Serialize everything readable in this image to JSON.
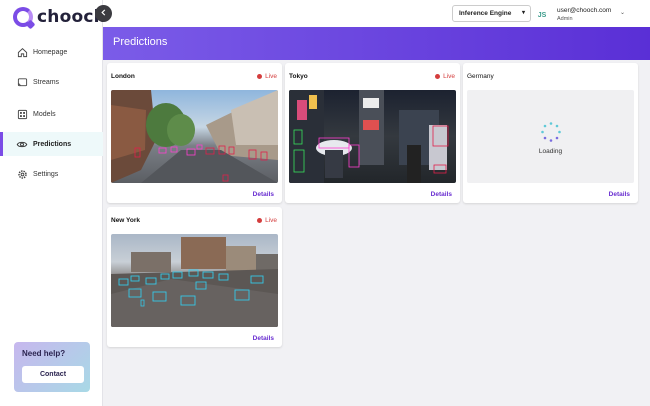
{
  "app": {
    "logo_text": "chooch"
  },
  "sidebar": {
    "items": [
      {
        "label": "Homepage",
        "icon": "home-icon"
      },
      {
        "label": "Streams",
        "icon": "cast-icon"
      },
      {
        "label": "Models",
        "icon": "models-icon"
      },
      {
        "label": "Predictions",
        "icon": "eye-icon",
        "active": true
      },
      {
        "label": "Settings",
        "icon": "gear-icon"
      }
    ],
    "help": {
      "title": "Need help?",
      "button": "Contact"
    }
  },
  "header": {
    "engine_select": "Inference Engine",
    "avatar_initials": "JS",
    "user_email": "user@chooch.com",
    "user_role": "Admin"
  },
  "page": {
    "title": "Predictions"
  },
  "cards": [
    {
      "title": "London",
      "status": "Live",
      "details": "Details"
    },
    {
      "title": "Tokyo",
      "status": "Live",
      "details": "Details"
    },
    {
      "title": "Germany",
      "status_text": "Loading",
      "details": "Details"
    },
    {
      "title": "New York",
      "status": "Live",
      "details": "Details"
    }
  ],
  "colors": {
    "accent": "#6a2fd1",
    "live": "#d43d3d",
    "title_bar_start": "#7b5ce8",
    "title_bar_end": "#5a2fd6"
  }
}
